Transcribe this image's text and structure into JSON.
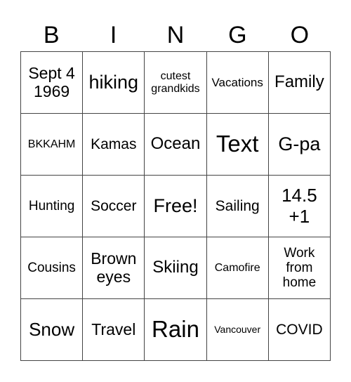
{
  "header": [
    "B",
    "I",
    "N",
    "G",
    "O"
  ],
  "cells": [
    [
      "Sept 4\n1969",
      "hiking",
      "cutest\ngrandkids",
      "Vacations",
      "Family"
    ],
    [
      "BKKAHM",
      "Kamas",
      "Ocean",
      "Text",
      "G-pa"
    ],
    [
      "Hunting",
      "Soccer",
      "Free!",
      "Sailing",
      "14.5\n+1"
    ],
    [
      "Cousins",
      "Brown\neyes",
      "Skiing",
      "Camofire",
      "Work\nfrom\nhome"
    ],
    [
      "Snow",
      "Travel",
      "Rain",
      "Vancouver",
      "COVID"
    ]
  ]
}
